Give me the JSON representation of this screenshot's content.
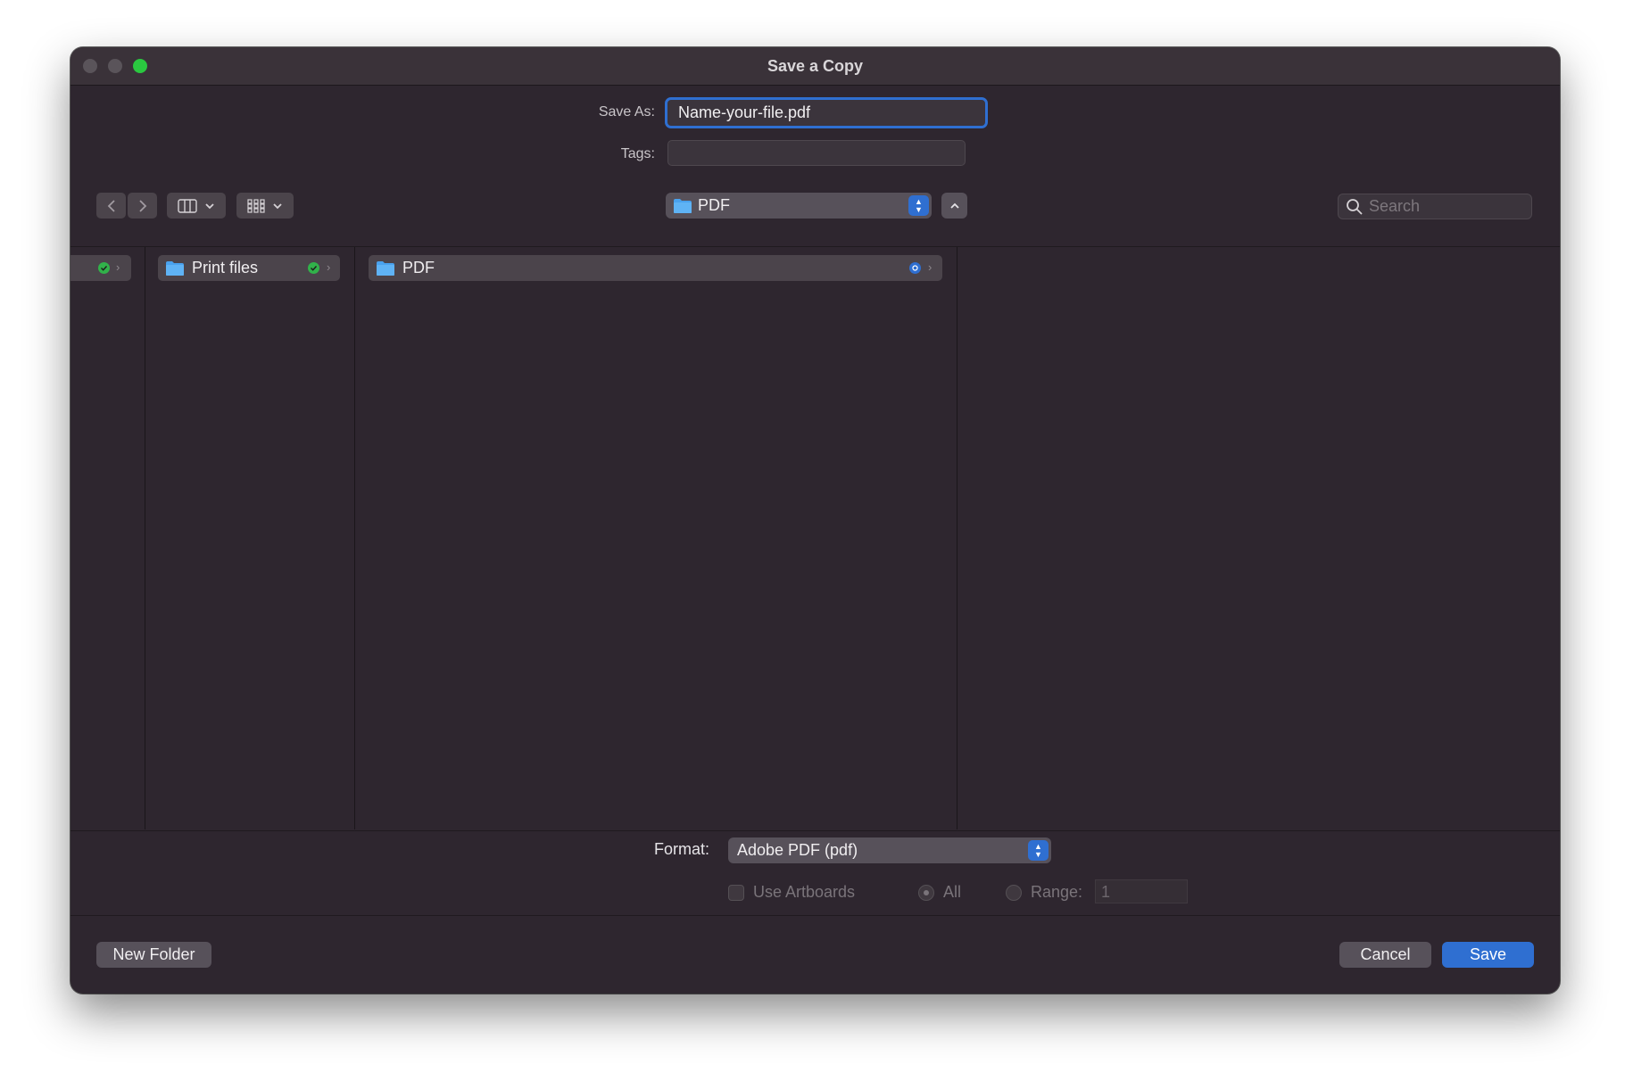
{
  "window": {
    "title": "Save a Copy"
  },
  "form": {
    "save_as_label": "Save As:",
    "save_as_value": "Name-your-file.pdf",
    "tags_label": "Tags:",
    "tags_value": ""
  },
  "toolbar": {
    "back_icon": "chevron-left-icon",
    "forward_icon": "chevron-right-icon",
    "column_view_icon": "columns-icon",
    "group_icon": "grid-icon",
    "path_folder": "PDF",
    "search_placeholder": "Search"
  },
  "browser": {
    "columns": [
      {
        "items": [
          {
            "name": "",
            "status": "synced"
          }
        ]
      },
      {
        "items": [
          {
            "name": "Print files",
            "status": "synced"
          }
        ]
      },
      {
        "items": [
          {
            "name": "PDF",
            "status": "syncing"
          }
        ]
      }
    ]
  },
  "options": {
    "format_label": "Format:",
    "format_value": "Adobe PDF (pdf)",
    "use_artboards_label": "Use Artboards",
    "all_label": "All",
    "range_label": "Range:",
    "range_value": "1"
  },
  "buttons": {
    "new_folder": "New Folder",
    "cancel": "Cancel",
    "save": "Save"
  },
  "colors": {
    "accent": "#2f6fd1",
    "window_bg": "#2e262f",
    "folder": "#49a2ee",
    "sync_ok": "#31b24a"
  }
}
